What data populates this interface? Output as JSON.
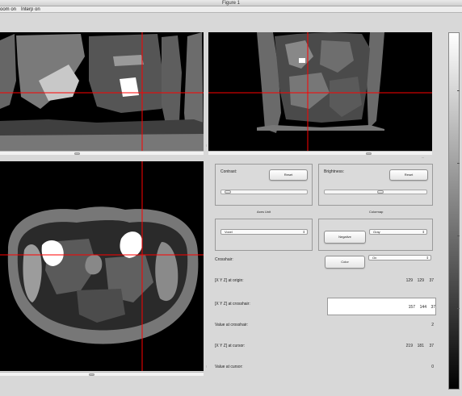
{
  "window": {
    "title": "Figure 1"
  },
  "menu": {
    "zoom": "oom on",
    "interp": "Interp on"
  },
  "panels": {
    "coronal": {
      "name": "coronal-view"
    },
    "sagittal": {
      "name": "sagittal-view"
    },
    "axial": {
      "name": "axial-view"
    }
  },
  "contrast": {
    "label": "Contrast:",
    "reset_label": "Reset",
    "slider_value": 0.04
  },
  "brightness": {
    "label": "Brightness:",
    "reset_label": "Reset",
    "slider_value": 0.55
  },
  "axes_unit": {
    "label": "Axes Unit",
    "value": "Voxel"
  },
  "colormap": {
    "label": "Colormap",
    "value": "Gray",
    "negative_label": "Negative"
  },
  "crosshair": {
    "label": "Crosshair:",
    "color_button": "Color",
    "value": "On"
  },
  "xyz_origin": {
    "label": "[X Y Z] at origin:",
    "x": "129",
    "y": "129",
    "z": "37"
  },
  "xyz_crosshair": {
    "label": "[X Y Z] at crosshair:",
    "x": "157",
    "y": "144",
    "z": "37"
  },
  "value_crosshair": {
    "label": "Value at crosshair:",
    "value": "2"
  },
  "xyz_cursor": {
    "label": "[X Y Z] at cursor:",
    "x": "219",
    "y": "181",
    "z": "37"
  },
  "value_cursor": {
    "label": "Value at cursor:",
    "value": "0"
  },
  "colors": {
    "crosshair": "#ff0000",
    "background": "#d8d8d8"
  }
}
